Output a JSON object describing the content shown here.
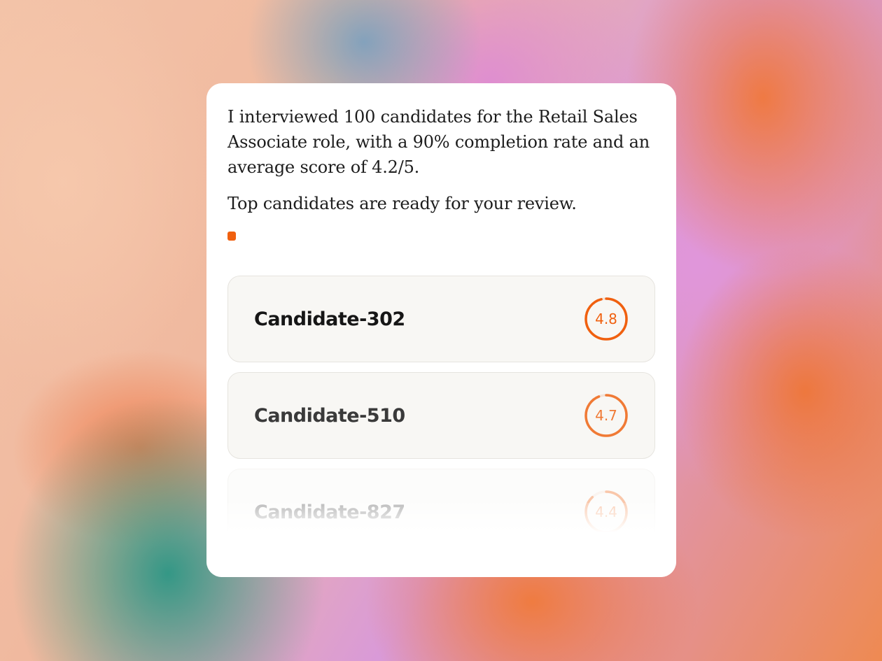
{
  "message": {
    "paragraph_1": "I interviewed 100 candidates for the Retail Sales Associate role, with a 90% completion rate and an average score of 4.2/5.",
    "paragraph_2": "Top candidates are ready for your review."
  },
  "candidates": [
    {
      "name": "Candidate-302",
      "score": "4.8",
      "score_fraction": 0.96
    },
    {
      "name": "Candidate-510",
      "score": "4.7",
      "score_fraction": 0.94
    },
    {
      "name": "Candidate-827",
      "score": "4.4",
      "score_fraction": 0.88
    }
  ],
  "colors": {
    "accent": "#f0600f",
    "ring_track": "#f3e2d6"
  }
}
